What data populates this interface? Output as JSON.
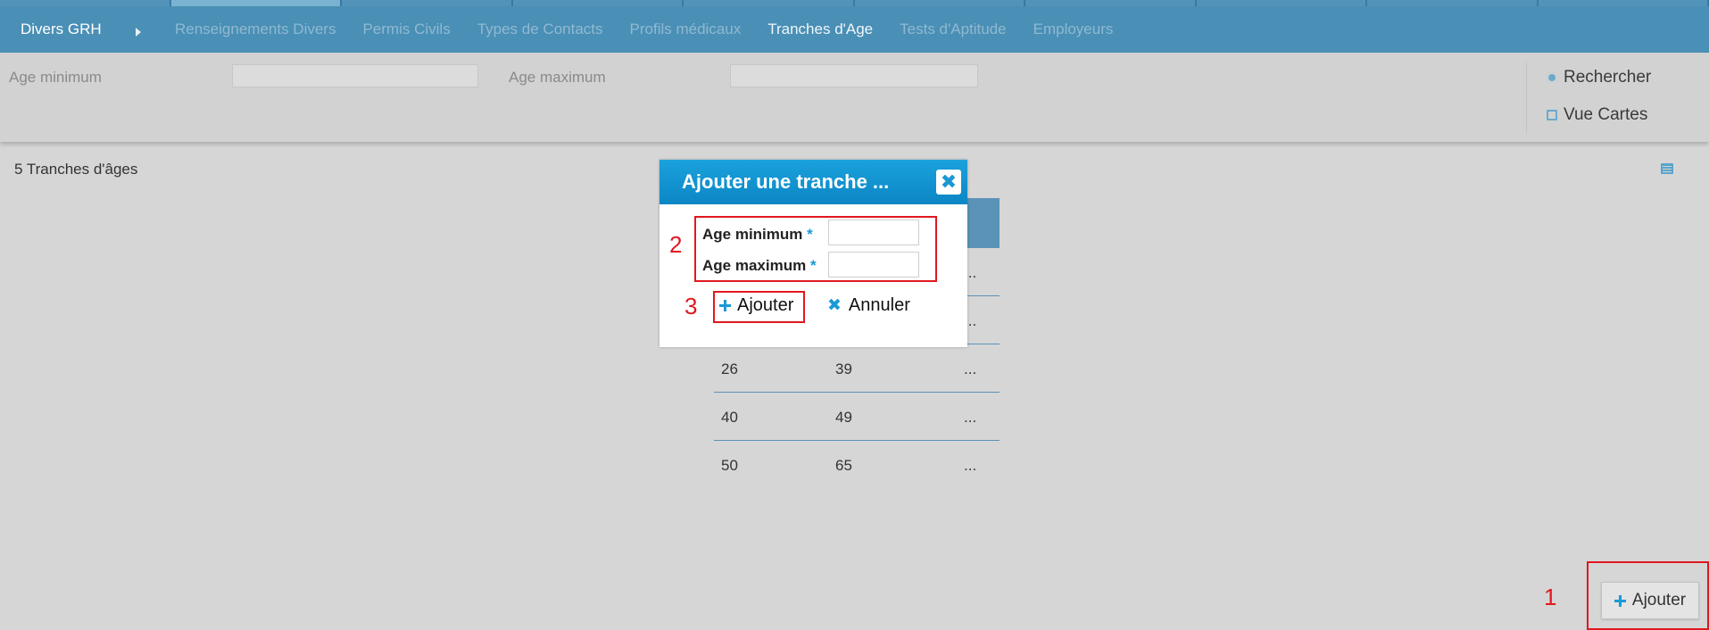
{
  "nav": {
    "root": "Divers GRH",
    "items": [
      {
        "label": "Renseignements Divers"
      },
      {
        "label": "Permis Civils"
      },
      {
        "label": "Types de Contacts"
      },
      {
        "label": "Profils médicaux"
      },
      {
        "label": "Tranches d'Age"
      },
      {
        "label": "Tests d'Aptitude"
      },
      {
        "label": "Employeurs"
      }
    ],
    "active": "Tranches d'Age"
  },
  "filter": {
    "age_min_label": "Age minimum",
    "age_max_label": "Age maximum",
    "age_min_value": "",
    "age_max_value": "",
    "search_label": "Rechercher",
    "cards_label": "Vue Cartes"
  },
  "summary": {
    "count_text": "5 Tranches d'âges"
  },
  "table": {
    "rows": [
      {
        "min": "",
        "max": "",
        "more": "..."
      },
      {
        "min": "",
        "max": "",
        "more": "..."
      },
      {
        "min": "26",
        "max": "39",
        "more": "..."
      },
      {
        "min": "40",
        "max": "49",
        "more": "..."
      },
      {
        "min": "50",
        "max": "65",
        "more": "..."
      }
    ]
  },
  "dialog": {
    "title": "Ajouter une tranche ...",
    "close_symbol": "✖",
    "age_min_label": "Age minimum",
    "age_max_label": "Age maximum",
    "required_mark": "*",
    "age_min_value": "",
    "age_max_value": "",
    "add_label": "Ajouter",
    "cancel_label": "Annuler",
    "cancel_symbol": "✖"
  },
  "annotations": {
    "one": "1",
    "two": "2",
    "three": "3"
  },
  "footer": {
    "add_label": "Ajouter"
  },
  "colors": {
    "accent": "#4a8fb5",
    "dialog_header": "#1496d2",
    "annotation": "#e0181f"
  }
}
